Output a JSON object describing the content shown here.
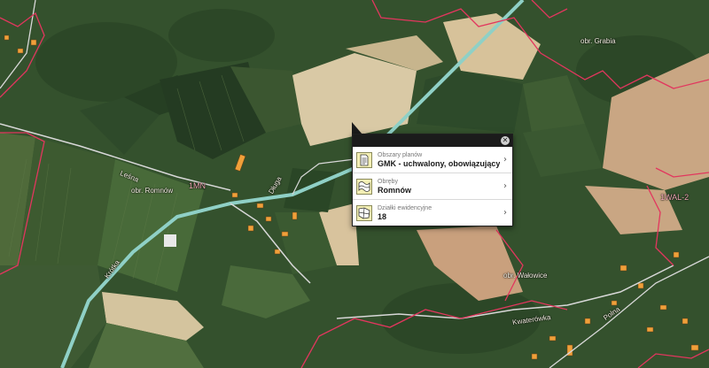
{
  "map": {
    "place_labels": [
      {
        "text": "obr. Grabia"
      },
      {
        "text": "obr. Romnów"
      },
      {
        "text": "obr. Wałowice"
      },
      {
        "text": "Kwaterówka"
      },
      {
        "text": "Leśna"
      },
      {
        "text": "Krótka"
      },
      {
        "text": "Długa"
      },
      {
        "text": "Polna"
      }
    ],
    "zone_labels": [
      {
        "text": "1MN"
      },
      {
        "text": "1WAL-2"
      }
    ],
    "colors": {
      "road": "#8fd0c6",
      "parcel_boundary": "#e2365e",
      "forest": "#365f2e",
      "field": "#c9b895",
      "building": "#f0a03a"
    }
  },
  "popup": {
    "close_icon": "close-icon",
    "rows": [
      {
        "icon": "document-icon",
        "label": "Obszary planów",
        "value": "GMK - uchwalony, obowiązujący"
      },
      {
        "icon": "map-area-icon",
        "label": "Obręby",
        "value": "Romnów"
      },
      {
        "icon": "parcel-icon",
        "label": "Działki ewidencyjne",
        "value": "18"
      }
    ]
  }
}
